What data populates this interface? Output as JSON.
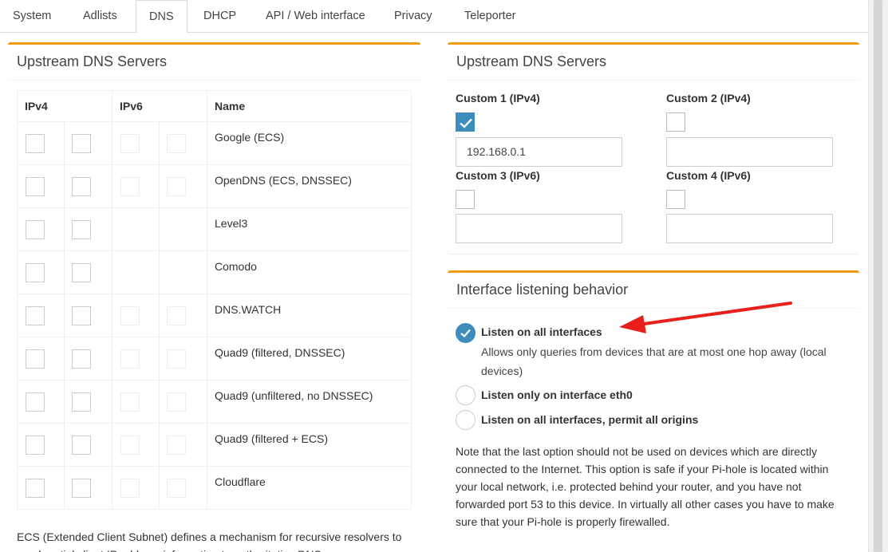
{
  "tabs": [
    "System",
    "Adlists",
    "DNS",
    "DHCP",
    "API / Web interface",
    "Privacy",
    "Teleporter"
  ],
  "active_tab": "DNS",
  "left_panel": {
    "title": "Upstream DNS Servers",
    "headers": {
      "ipv4": "IPv4",
      "ipv6": "IPv6",
      "name": "Name"
    },
    "rows": [
      {
        "name": "Google (ECS)",
        "has_ipv6": true
      },
      {
        "name": "OpenDNS (ECS, DNSSEC)",
        "has_ipv6": true
      },
      {
        "name": "Level3",
        "has_ipv6": false
      },
      {
        "name": "Comodo",
        "has_ipv6": false
      },
      {
        "name": "DNS.WATCH",
        "has_ipv6": true
      },
      {
        "name": "Quad9 (filtered, DNSSEC)",
        "has_ipv6": true
      },
      {
        "name": "Quad9 (unfiltered, no DNSSEC)",
        "has_ipv6": true
      },
      {
        "name": "Quad9 (filtered + ECS)",
        "has_ipv6": true
      },
      {
        "name": "Cloudflare",
        "has_ipv6": true
      }
    ],
    "ecs_note": "ECS (Extended Client Subnet) defines a mechanism for recursive resolvers to send partial client IP address information to authoritative DNS name servers."
  },
  "custom_panel": {
    "title": "Upstream DNS Servers",
    "custom1_label": "Custom 1 (IPv4)",
    "custom1_value": "192.168.0.1",
    "custom1_checked": true,
    "custom2_label": "Custom 2 (IPv4)",
    "custom2_value": "",
    "custom3_label": "Custom 3 (IPv6)",
    "custom3_value": "",
    "custom4_label": "Custom 4 (IPv6)",
    "custom4_value": ""
  },
  "interface_panel": {
    "title": "Interface listening behavior",
    "options": [
      {
        "label": "Listen on all interfaces",
        "desc": "Allows only queries from devices that are at most one hop away (local devices)",
        "selected": true
      },
      {
        "label": "Listen only on interface eth0",
        "desc": "",
        "selected": false
      },
      {
        "label": "Listen on all interfaces, permit all origins",
        "desc": "",
        "selected": false
      }
    ],
    "note": "Note that the last option should not be used on devices which are directly connected to the Internet. This option is safe if your Pi-hole is located within your local network, i.e. protected behind your router, and you have not forwarded port 53 to this device. In virtually all other cases you have to make sure that your Pi-hole is properly firewalled."
  },
  "colors": {
    "accent": "#f39c12",
    "primary": "#3c8dbc",
    "arrow": "#e8201c"
  }
}
